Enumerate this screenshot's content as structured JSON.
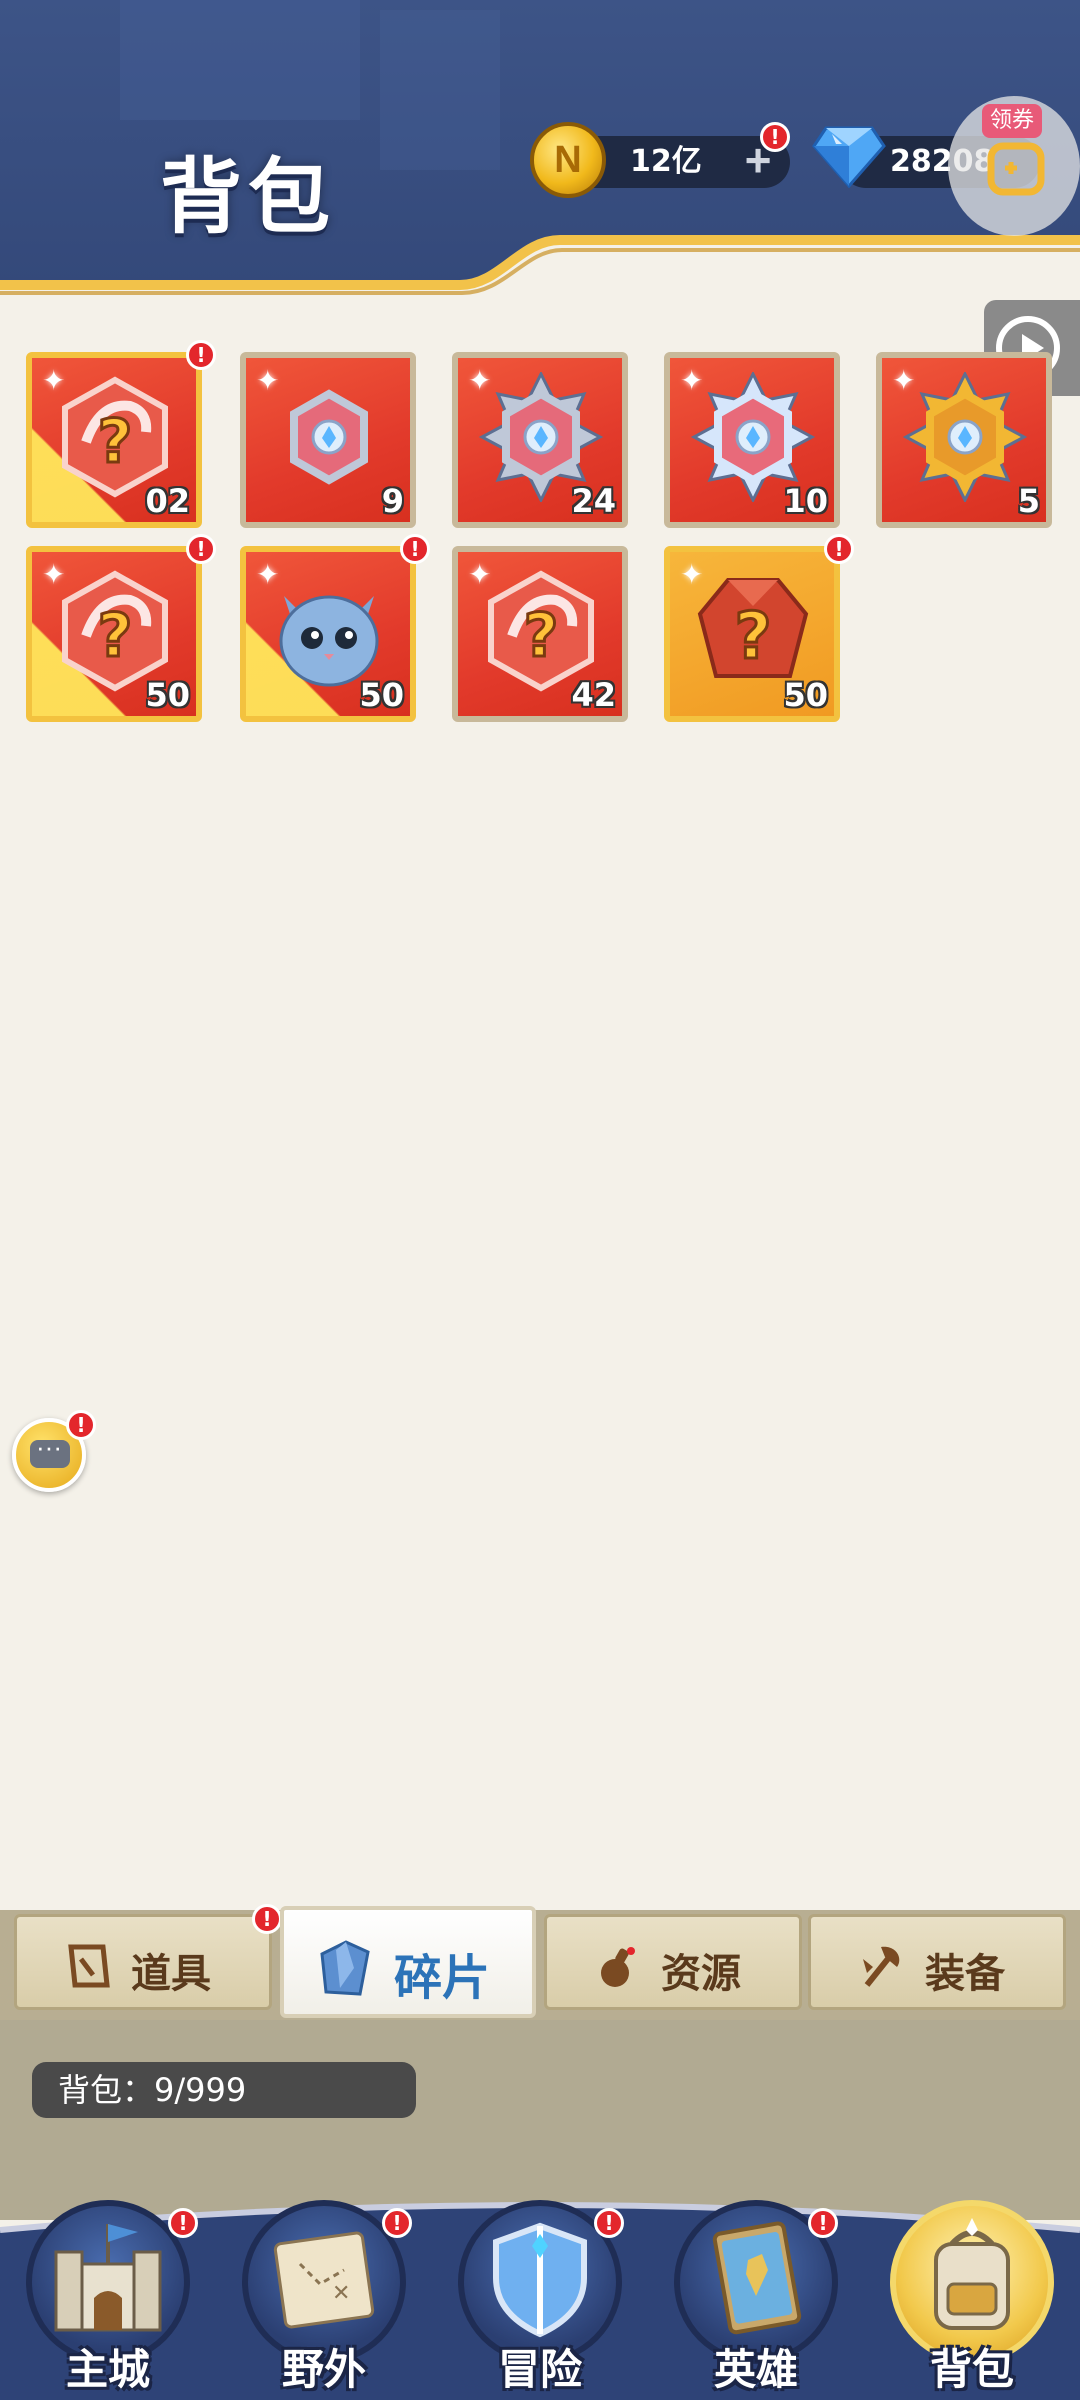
{
  "header": {
    "title": "背包",
    "gold_amount": "12亿",
    "gem_amount": "28208",
    "plus_symbol": "+",
    "coupon_label": "领券",
    "alert_symbol": "!"
  },
  "items": [
    {
      "qty": "02",
      "style": "gold",
      "icon": "hero-shard-mystery-icon",
      "alert": true
    },
    {
      "qty": "9",
      "style": "red",
      "icon": "emblem-hexagon-icon",
      "alert": false
    },
    {
      "qty": "24",
      "style": "red",
      "icon": "emblem-star-icon",
      "alert": false
    },
    {
      "qty": "10",
      "style": "red",
      "icon": "emblem-snowflake-icon",
      "alert": false
    },
    {
      "qty": "5",
      "style": "red",
      "icon": "emblem-gold-icon",
      "alert": false
    },
    {
      "qty": "50",
      "style": "gold",
      "icon": "hero-shard-mystery-icon",
      "alert": true
    },
    {
      "qty": "50",
      "style": "gold",
      "icon": "cat-hero-icon",
      "alert": true
    },
    {
      "qty": "42",
      "style": "red",
      "icon": "emblem-mystery-icon",
      "alert": false
    },
    {
      "qty": "50",
      "style": "orange",
      "icon": "mystery-gem-icon",
      "alert": true
    }
  ],
  "tabs": [
    {
      "label": "道具",
      "icon": "item-tag-icon",
      "active": false
    },
    {
      "label": "碎片",
      "icon": "fragment-icon",
      "active": true
    },
    {
      "label": "资源",
      "icon": "potion-icon",
      "active": false
    },
    {
      "label": "装备",
      "icon": "axe-icon",
      "active": false
    }
  ],
  "capacity": "背包：9/999",
  "nav": [
    {
      "label": "主城",
      "icon": "castle-icon",
      "alert": true
    },
    {
      "label": "野外",
      "icon": "map-scroll-icon",
      "alert": true
    },
    {
      "label": "冒险",
      "icon": "shield-icon",
      "alert": true
    },
    {
      "label": "英雄",
      "icon": "hero-card-icon",
      "alert": true
    },
    {
      "label": "背包",
      "icon": "backpack-icon",
      "alert": false
    }
  ],
  "colors": {
    "header_bg": "#3e5688",
    "gold_trim": "#f2c24a",
    "item_red": "#e23a2b",
    "tab_active_text": "#2c73b8",
    "alert": "#e3262c"
  }
}
